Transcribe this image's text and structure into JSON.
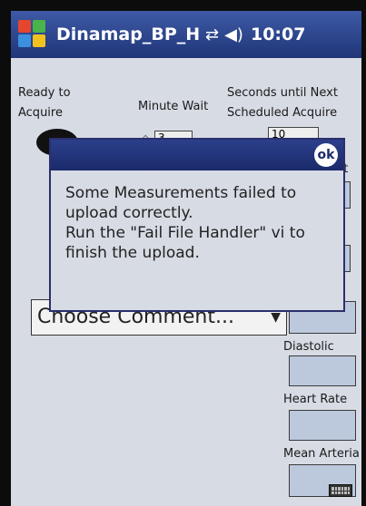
{
  "titlebar": {
    "app_title": "Dinamap_BP_HR_",
    "time": "10:07",
    "icons": [
      "windows-start-icon",
      "connectivity-icon",
      "volume-icon"
    ]
  },
  "form": {
    "ready_label": "Ready to Acquire",
    "minute_wait_label": "Minute Wait",
    "minute_wait_value": "3",
    "seconds_label": "Seconds until Next Scheduled Acquire",
    "seconds_value": "10",
    "comment_label": "ent",
    "comment_select": "Choose Comment...",
    "diastolic_label": "Diastolic",
    "heart_rate_label": "Heart Rate",
    "mean_arterial_label": "Mean Arteria"
  },
  "dialog": {
    "ok_label": "ok",
    "message_lines": [
      "Some Measurements failed to",
      "upload correctly.",
      "Run the \"Fail File Handler\" vi to",
      "finish the upload."
    ]
  }
}
